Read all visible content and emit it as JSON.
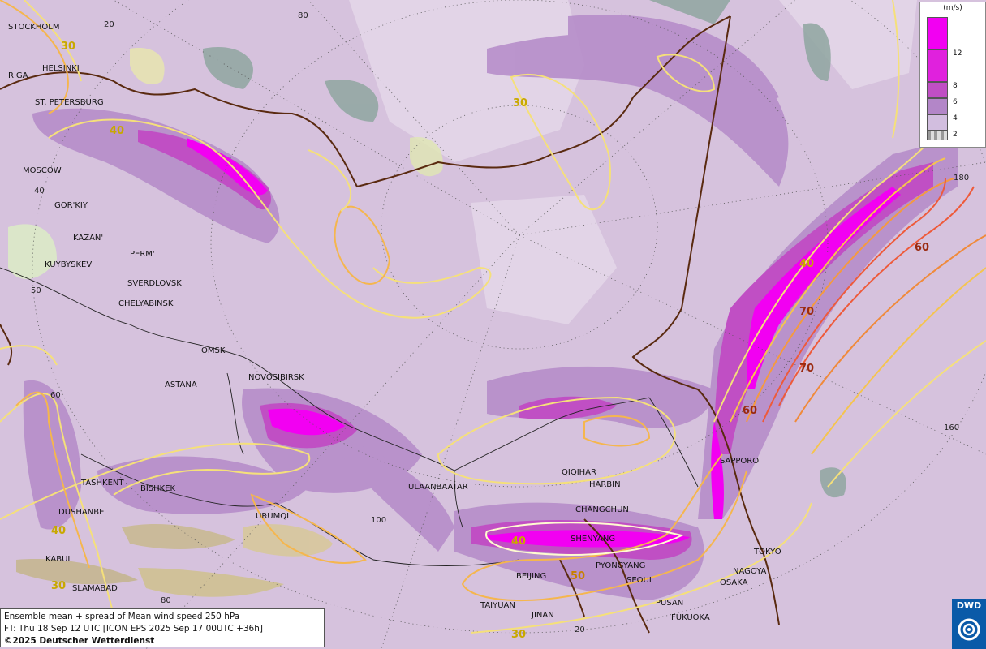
{
  "legend": {
    "unit": "(m/s)",
    "levels": [
      {
        "value": "",
        "color": "#f200f2"
      },
      {
        "value": "12",
        "color": "#e021dd"
      },
      {
        "value": "8",
        "color": "#c04fc4"
      },
      {
        "value": "6",
        "color": "#b386c8"
      },
      {
        "value": "4",
        "color": "#d2bedf"
      },
      {
        "value": "2",
        "color": "#999999"
      }
    ]
  },
  "info": {
    "line1": "Ensemble mean + spread of Mean wind speed 250 hPa",
    "line2": "FT: Thu 18 Sep 12 UTC [ICON EPS 2025 Sep 17 00UTC +36h]",
    "copyright": "©2025 Deutscher Wetterdienst"
  },
  "logo": {
    "text": "DWD"
  },
  "cities": [
    "STOCKHOLM",
    "HELSINKI",
    "RIGA",
    "ST. PETERSBURG",
    "MOSCOW",
    "GOR'KIY",
    "KAZAN'",
    "PERM'",
    "KUYBYSKEV",
    "SVERDLOVSK",
    "CHELYABINSK",
    "OMSK",
    "ASTANA",
    "NOVOSIBIRSK",
    "TASHKENT",
    "BISHKEK",
    "DUSHANBE",
    "URUMQI",
    "KABUL",
    "ISLAMABAD",
    "ULAANBAATAR",
    "QIQIHAR",
    "HARBIN",
    "CHANGCHUN",
    "SHENYANG",
    "BEIJING",
    "TAIYUAN",
    "JINAN",
    "PYONGYANG",
    "SEOUL",
    "PUSAN",
    "FUKUOKA",
    "OSAKA",
    "NAGOYA",
    "TOKYO",
    "SAPPORO"
  ],
  "grid_labels": [
    "20",
    "80",
    "40",
    "50",
    "60",
    "100",
    "180",
    "160",
    "80",
    "20",
    "40",
    "30",
    "40",
    "30"
  ],
  "contour_labels": [
    "30",
    "40",
    "30",
    "40",
    "70",
    "70",
    "60",
    "60",
    "40",
    "50",
    "30",
    "40",
    "30"
  ]
}
